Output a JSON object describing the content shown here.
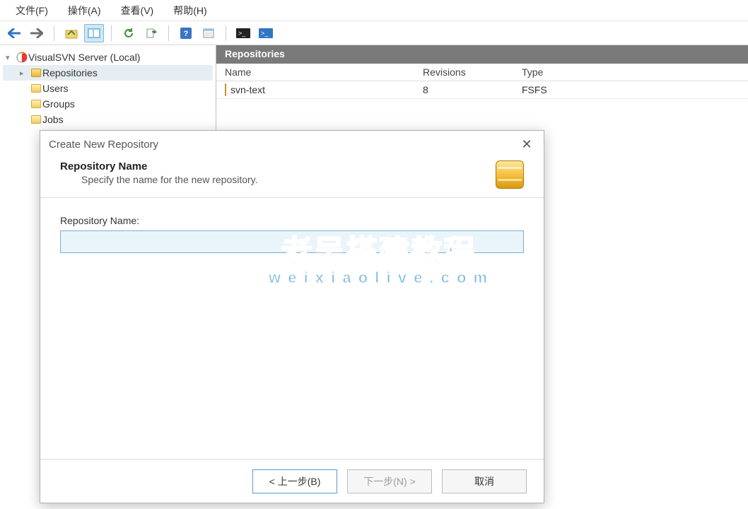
{
  "menu": {
    "file": "文件(F)",
    "action": "操作(A)",
    "view": "查看(V)",
    "help": "帮助(H)"
  },
  "tree": {
    "root": "VisualSVN Server (Local)",
    "items": [
      "Repositories",
      "Users",
      "Groups",
      "Jobs"
    ]
  },
  "list": {
    "title": "Repositories",
    "head": {
      "name": "Name",
      "rev": "Revisions",
      "type": "Type"
    },
    "rows": [
      {
        "name": "svn-text",
        "rev": "8",
        "type": "FSFS"
      }
    ]
  },
  "dialog": {
    "title": "Create New Repository",
    "hdr_title": "Repository Name",
    "hdr_sub": "Specify the name for the new repository.",
    "field_label": "Repository Name:",
    "field_value": "",
    "btn_back": "< 上一步(B)",
    "btn_next": "下一步(N) >",
    "btn_cancel": "取消"
  },
  "watermark": {
    "l1": "老吴搭建教程",
    "l2": "w e i x i a o l i v e . c o m"
  }
}
